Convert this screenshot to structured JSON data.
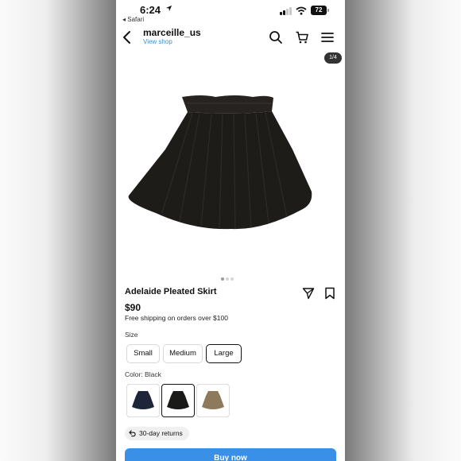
{
  "status_bar": {
    "time": "6:24",
    "back_app": "◂ Safari",
    "battery": "72"
  },
  "header": {
    "shop_name": "marceille_us",
    "view_shop": "View shop",
    "icons": [
      "back-arrow-icon",
      "search-icon",
      "cart-icon",
      "menu-icon"
    ]
  },
  "gallery": {
    "counter": "1/4",
    "image": "black pleated paperbag-waist skirt"
  },
  "product": {
    "title": "Adelaide Pleated Skirt",
    "price": "$90",
    "shipping": "Free shipping on orders over $100"
  },
  "size": {
    "label": "Size",
    "options": [
      "Small",
      "Medium",
      "Large"
    ],
    "selected": "Large"
  },
  "color": {
    "label": "Color: Black",
    "swatches": [
      {
        "name": "navy",
        "hex": "#1f2538"
      },
      {
        "name": "black",
        "hex": "#1a1a18"
      },
      {
        "name": "tan",
        "hex": "#8d7a5c"
      }
    ],
    "selected": "black"
  },
  "returns": "30-day returns",
  "buy_button": "Buy now",
  "colors": {
    "accent": "#3a8fe6",
    "link": "#3b8fd8"
  }
}
